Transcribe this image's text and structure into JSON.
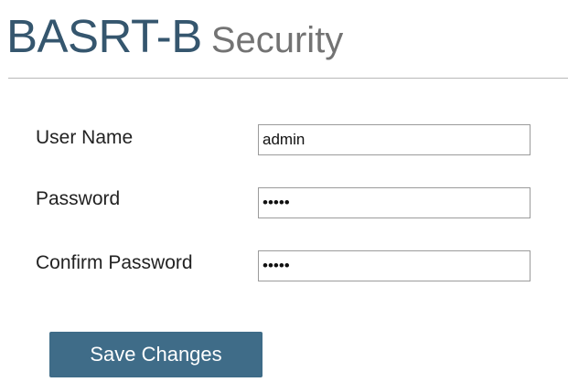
{
  "header": {
    "device_name": "BASRT-B",
    "page_name": "Security"
  },
  "form": {
    "user_name": {
      "label": "User Name",
      "value": "admin"
    },
    "password": {
      "label": "Password",
      "value": "•••••"
    },
    "confirm_password": {
      "label": "Confirm Password",
      "value": "•••••"
    },
    "save_label": "Save Changes"
  },
  "colors": {
    "brand": "#35566e",
    "subtitle": "#737373",
    "button": "#3f6c88"
  }
}
